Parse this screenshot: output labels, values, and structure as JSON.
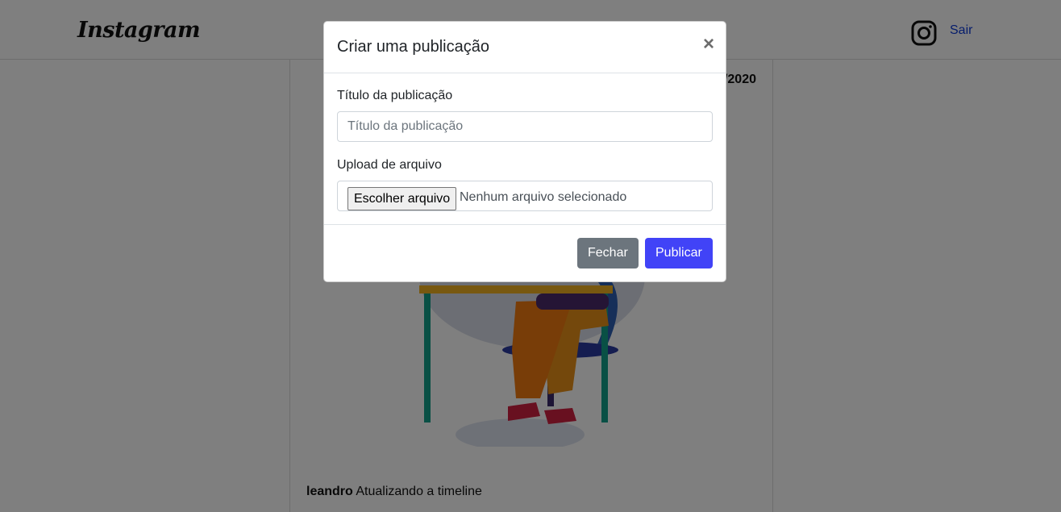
{
  "header": {
    "logo": "Instagram",
    "logout_label": "Sair"
  },
  "post": {
    "date": "/2020",
    "username": "leandro",
    "caption": "Atualizando a timeline"
  },
  "modal": {
    "title": "Criar uma publicação",
    "close_symbol": "×",
    "title_label": "Título da publicação",
    "title_placeholder": "Título da publicação",
    "file_label": "Upload de arquivo",
    "file_button": "Escolher arquivo",
    "file_status": "Nenhum arquivo selecionado",
    "cancel_label": "Fechar",
    "submit_label": "Publicar"
  },
  "colors": {
    "publish_button": "#4143f7",
    "close_button": "#6c757d",
    "link": "#0d3bd9"
  },
  "icons": {
    "header_right": "instagram-icon"
  }
}
